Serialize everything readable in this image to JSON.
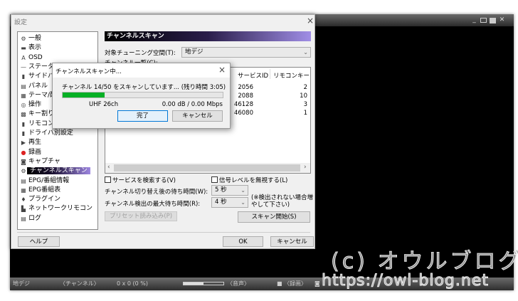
{
  "app": {
    "window_buttons": [
      "minimize",
      "restore",
      "maximize",
      "close"
    ],
    "status_bar": {
      "tuning_space": "地デジ",
      "channel": "〈チャンネル〉",
      "video": "0 x 0 (0 %)",
      "audio": "〈音声〉",
      "record": "〈録画〉",
      "volume_level": 0.5
    }
  },
  "settings": {
    "title": "設定",
    "sidebar": [
      {
        "label": "一般",
        "icon": "gear"
      },
      {
        "label": "表示",
        "icon": "display"
      },
      {
        "label": "OSD",
        "icon": "osd"
      },
      {
        "label": "ステータスバー",
        "icon": "statusbar"
      },
      {
        "label": "サイドバー",
        "icon": "sidebar"
      },
      {
        "label": "パネル",
        "icon": "panel"
      },
      {
        "label": "テーマ/配色",
        "icon": "theme"
      },
      {
        "label": "操作",
        "icon": "mouse"
      },
      {
        "label": "キー割り当て",
        "icon": "keyboard"
      },
      {
        "label": "リモコン",
        "icon": "remote"
      },
      {
        "label": "ドライバ別設定",
        "icon": "driver"
      },
      {
        "label": "再生",
        "icon": "play"
      },
      {
        "label": "録画",
        "icon": "record"
      },
      {
        "label": "キャプチャ",
        "icon": "camera"
      },
      {
        "label": "チャンネルスキャン",
        "icon": "scan",
        "selected": true
      },
      {
        "label": "EPG/番組情報",
        "icon": "epg"
      },
      {
        "label": "EPG番組表",
        "icon": "epg-table"
      },
      {
        "label": "プラグイン",
        "icon": "plugin"
      },
      {
        "label": "ネットワークリモコン",
        "icon": "network"
      },
      {
        "label": "ログ",
        "icon": "log"
      }
    ],
    "page_title": "チャンネルスキャン",
    "tuning_space_label": "対象チューニング空間(T):",
    "tuning_space_value": "地デジ",
    "channel_list_label": "チャンネル一覧(C):",
    "columns": [
      "サービスID",
      "リモコンキー"
    ],
    "rows": [
      {
        "service_id": "2056",
        "remote_key": "2"
      },
      {
        "service_id": "2088",
        "remote_key": "10"
      },
      {
        "service_id": "46128",
        "remote_key": "3"
      },
      {
        "service_id": "46080",
        "remote_key": "1"
      }
    ],
    "search_services": "サービスを検索する(V)",
    "ignore_signal": "信号レベルを無視する(L)",
    "wait_after_switch_label": "チャンネル切り替え後の待ち時間(W):",
    "wait_after_switch": "5 秒",
    "max_detect_label": "チャンネル検出の最大待ち時間(R):",
    "max_detect": "4 秒",
    "note": "(※検出されない場合増やして下さい)",
    "preset_button": "プリセット読み込み(P)",
    "scan_button": "スキャン開始(S)",
    "help_button": "ヘルプ",
    "ok_button": "OK",
    "cancel_button": "キャンセル"
  },
  "scan_dialog": {
    "title": "チャンネルスキャン中...",
    "message": "チャンネル 14/50 をスキャンしています... (残り時間 3:05)",
    "progress_percent": 26,
    "progress_color": "#06b025",
    "channel": "UHF 26ch",
    "signal": "0.00 dB / 0.00 Mbps",
    "done_button": "完了",
    "cancel_button": "キャンセル"
  },
  "watermark": {
    "line1": "(c) オウルブログ",
    "line2": "https://owl-blog.net"
  }
}
